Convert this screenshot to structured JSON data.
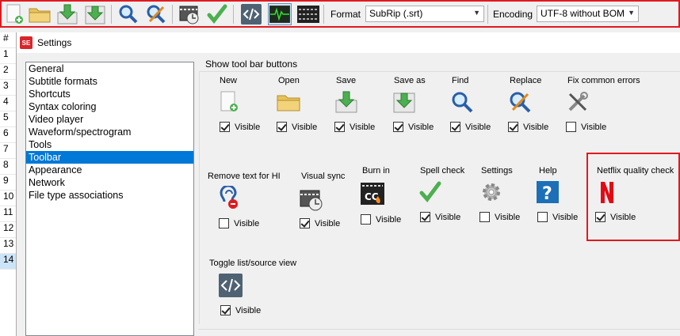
{
  "toolbar": {
    "format_label": "Format",
    "format_value": "SubRip (.srt)",
    "encoding_label": "Encoding",
    "encoding_value": "UTF-8 without BOM",
    "highlight_color": "#e0191f"
  },
  "row_numbers": [
    "#",
    "1",
    "2",
    "3",
    "4",
    "5",
    "6",
    "7",
    "8",
    "9",
    "10",
    "11",
    "12",
    "13",
    "14"
  ],
  "settings": {
    "title": "Settings",
    "nav": [
      "General",
      "Subtitle formats",
      "Shortcuts",
      "Syntax coloring",
      "Video player",
      "Waveform/spectrogram",
      "Tools",
      "Toolbar",
      "Appearance",
      "Network",
      "File type associations"
    ],
    "selected_nav": "Toolbar",
    "group_title": "Show tool bar buttons",
    "visible_label": "Visible",
    "items": [
      {
        "label": "New",
        "checked": true,
        "icon": "new-file-icon"
      },
      {
        "label": "Open",
        "checked": true,
        "icon": "folder-icon"
      },
      {
        "label": "Save",
        "checked": true,
        "icon": "save-icon"
      },
      {
        "label": "Save as",
        "checked": true,
        "icon": "save-as-icon"
      },
      {
        "label": "Find",
        "checked": true,
        "icon": "find-icon"
      },
      {
        "label": "Replace",
        "checked": true,
        "icon": "replace-icon"
      },
      {
        "label": "Fix common errors",
        "checked": false,
        "icon": "fix-errors-icon"
      },
      {
        "label": "Remove text for HI",
        "checked": false,
        "icon": "hearing-impaired-icon"
      },
      {
        "label": "Visual sync",
        "checked": true,
        "icon": "visual-sync-icon"
      },
      {
        "label": "Burn in",
        "checked": false,
        "icon": "burn-in-icon"
      },
      {
        "label": "Spell check",
        "checked": true,
        "icon": "spell-check-icon"
      },
      {
        "label": "Settings",
        "checked": false,
        "icon": "settings-gear-icon"
      },
      {
        "label": "Help",
        "checked": false,
        "icon": "help-icon"
      },
      {
        "label": "Netflix quality check",
        "checked": true,
        "icon": "netflix-icon"
      },
      {
        "label": "Toggle list/source view",
        "checked": true,
        "icon": "source-view-icon"
      }
    ]
  }
}
